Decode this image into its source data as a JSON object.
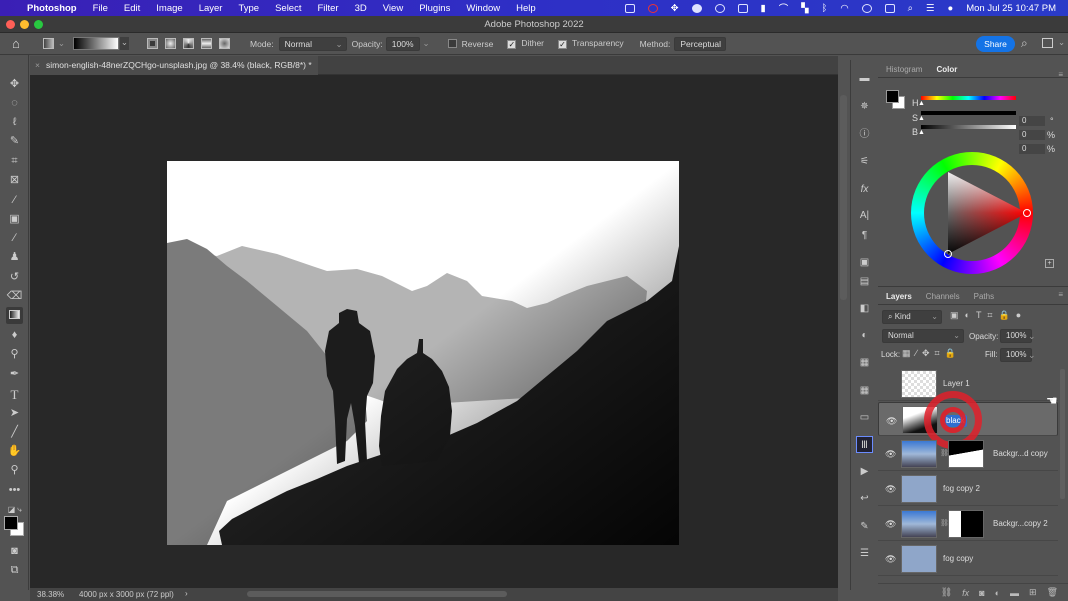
{
  "menubar": {
    "app": "Photoshop",
    "items": [
      "File",
      "Edit",
      "Image",
      "Layer",
      "Type",
      "Select",
      "Filter",
      "3D",
      "View",
      "Plugins",
      "Window",
      "Help"
    ],
    "clock": "Mon Jul 25  10:47 PM"
  },
  "window": {
    "title": "Adobe Photoshop 2022"
  },
  "options": {
    "mode_label": "Mode:",
    "mode_value": "Normal",
    "opacity_label": "Opacity:",
    "opacity_value": "100%",
    "reverse_label": "Reverse",
    "reverse_checked": false,
    "dither_label": "Dither",
    "dither_checked": true,
    "transparency_label": "Transparency",
    "transparency_checked": true,
    "method_label": "Method:",
    "method_value": "Perceptual",
    "share_label": "Share"
  },
  "document": {
    "tab_title": "simon-english-48nerZQCHgo-unsplash.jpg @ 38.4% (black, RGB/8*) *",
    "zoom": "38.38%",
    "info": "4000 px x 3000 px (72 ppl)"
  },
  "color_panel": {
    "tabs": [
      "Histogram",
      "Color"
    ],
    "active_tab": "Color",
    "h_label": "H",
    "h_value": "0",
    "h_unit": "°",
    "s_label": "S",
    "s_value": "0",
    "s_unit": "%",
    "b_label": "B",
    "b_value": "0",
    "b_unit": "%",
    "foreground": "#000000",
    "background": "#ffffff"
  },
  "layers_panel": {
    "tabs": [
      "Layers",
      "Channels",
      "Paths"
    ],
    "active_tab": "Layers",
    "filter_value": "Kind",
    "blend_mode": "Normal",
    "opacity_label": "Opacity:",
    "opacity_value": "100%",
    "lock_label": "Lock:",
    "fill_label": "Fill:",
    "fill_value": "100%",
    "layers": [
      {
        "name": "Layer 1",
        "visible": false,
        "selected": false
      },
      {
        "name": "black",
        "visible": true,
        "selected": true,
        "editing": true
      },
      {
        "name": "Backgr...d copy",
        "visible": true,
        "selected": false,
        "has_mask": true
      },
      {
        "name": "fog copy 2",
        "visible": true,
        "selected": false
      },
      {
        "name": "Backgr...copy 2",
        "visible": true,
        "selected": false,
        "has_mask": true
      },
      {
        "name": "fog copy",
        "visible": true,
        "selected": false
      }
    ]
  },
  "colors": {
    "accent": "#1473e6",
    "click_ring": "#e0202a",
    "fog": "#8fa6c9"
  }
}
